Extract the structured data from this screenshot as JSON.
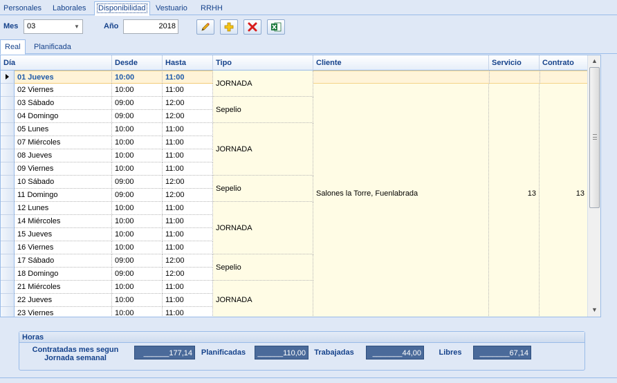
{
  "top_tabs": [
    "Personales",
    "Laborales",
    "Disponibilidad",
    "Vestuario",
    "RRHH"
  ],
  "filters": {
    "mes_label": "Mes",
    "mes_value": "03",
    "anio_label": "Año",
    "anio_value": "2018"
  },
  "toolbar_icons": [
    "pencil-icon",
    "plus-icon",
    "delete-icon",
    "excel-icon"
  ],
  "sub_tabs": [
    "Real",
    "Planificada"
  ],
  "columns": [
    "Día",
    "Desde",
    "Hasta",
    "Tipo",
    "Cliente",
    "Servicio",
    "Contrato"
  ],
  "rows": [
    {
      "dia": "01 Jueves",
      "desde": "10:00",
      "hasta": "11:00"
    },
    {
      "dia": "02 Viernes",
      "desde": "10:00",
      "hasta": "11:00"
    },
    {
      "dia": "03 Sábado",
      "desde": "09:00",
      "hasta": "12:00"
    },
    {
      "dia": "04 Domingo",
      "desde": "09:00",
      "hasta": "12:00"
    },
    {
      "dia": "05 Lunes",
      "desde": "10:00",
      "hasta": "11:00"
    },
    {
      "dia": "07 Miércoles",
      "desde": "10:00",
      "hasta": "11:00"
    },
    {
      "dia": "08 Jueves",
      "desde": "10:00",
      "hasta": "11:00"
    },
    {
      "dia": "09 Viernes",
      "desde": "10:00",
      "hasta": "11:00"
    },
    {
      "dia": "10 Sábado",
      "desde": "09:00",
      "hasta": "12:00"
    },
    {
      "dia": "11 Domingo",
      "desde": "09:00",
      "hasta": "12:00"
    },
    {
      "dia": "12 Lunes",
      "desde": "10:00",
      "hasta": "11:00"
    },
    {
      "dia": "14 Miércoles",
      "desde": "10:00",
      "hasta": "11:00"
    },
    {
      "dia": "15 Jueves",
      "desde": "10:00",
      "hasta": "11:00"
    },
    {
      "dia": "16 Viernes",
      "desde": "10:00",
      "hasta": "11:00"
    },
    {
      "dia": "17 Sábado",
      "desde": "09:00",
      "hasta": "12:00"
    },
    {
      "dia": "18 Domingo",
      "desde": "09:00",
      "hasta": "12:00"
    },
    {
      "dia": "21 Miércoles",
      "desde": "10:00",
      "hasta": "11:00"
    },
    {
      "dia": "22 Jueves",
      "desde": "10:00",
      "hasta": "11:00"
    },
    {
      "dia": "23 Viernes",
      "desde": "10:00",
      "hasta": "11:00"
    }
  ],
  "tipo_groups": [
    {
      "label": "JORNADA",
      "span": 2
    },
    {
      "label": "Sepelio",
      "span": 2
    },
    {
      "label": "JORNADA",
      "span": 4
    },
    {
      "label": "Sepelio",
      "span": 2
    },
    {
      "label": "JORNADA",
      "span": 4
    },
    {
      "label": "Sepelio",
      "span": 2
    },
    {
      "label": "JORNADA",
      "span": 3
    }
  ],
  "cliente": "Salones la Torre, Fuenlabrada",
  "servicio": "13",
  "contrato": "13",
  "horas": {
    "title": "Horas",
    "contratadas_label": "Contratadas mes segun Jornada semanal",
    "contratadas_value": "______177,14",
    "planificadas_label": "Planificadas",
    "planificadas_value": "______110,00",
    "trabajadas_label": "Trabajadas",
    "trabajadas_value": "_______44,00",
    "libres_label": "Libres",
    "libres_value": "_______67,14"
  }
}
